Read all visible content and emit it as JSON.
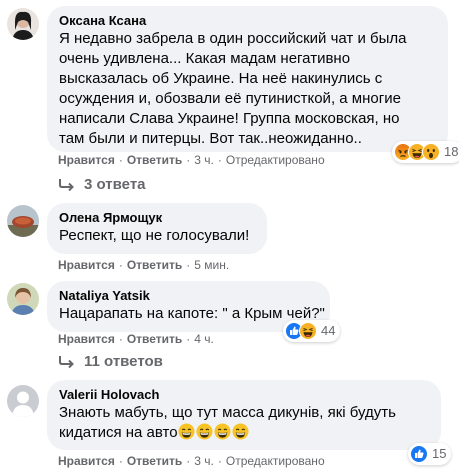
{
  "comments": [
    {
      "author": "Оксана Ксана",
      "lines": [
        "Я недавно забрела в один российский чат и была",
        "очень удивлена... Какая мадам негативно",
        "высказалась об Украине. На неё накинулись с",
        "осуждения и, обозвали её путинисткой, а многие",
        "написали Слава Украине! Группа московская, но",
        "там были и питерцы. Вот так..неожиданно.."
      ],
      "like_label": "Нравится",
      "reply_label": "Ответить",
      "time": "3 ч.",
      "edited": "Отредактировано",
      "reaction_count": "18",
      "reaction_icons": [
        "angry-reaction-icon",
        "haha-reaction-icon",
        "wow-reaction-icon"
      ],
      "replies_label": "3 ответа"
    },
    {
      "author": "Олена Ярмощук",
      "lines": [
        "Респект, що не голосували!"
      ],
      "like_label": "Нравится",
      "reply_label": "Ответить",
      "time": "5 мин."
    },
    {
      "author": "Nataliya Yatsik",
      "lines": [
        "Нацарапать на капоте: \" а Крым чей?\""
      ],
      "like_label": "Нравится",
      "reply_label": "Ответить",
      "time": "4 ч.",
      "reaction_count": "44",
      "reaction_icons": [
        "like-reaction-icon",
        "haha-reaction-icon"
      ],
      "replies_label": "11 ответов"
    },
    {
      "author": "Valerii Holovach",
      "lines": [
        "Знають мабуть, що тут масса дикунів, які будуть",
        "кидатися на авто"
      ],
      "trailing_emoji": [
        "grin-emoji",
        "grin-emoji",
        "grin-emoji",
        "grin-emoji"
      ],
      "like_label": "Нравится",
      "reply_label": "Ответить",
      "time": "3 ч.",
      "edited": "Отредактировано",
      "reaction_count": "15",
      "reaction_icons": [
        "like-reaction-icon"
      ]
    }
  ],
  "colors": {
    "bubble": "#f0f2f5",
    "meta_text": "#65676b",
    "like_blue": "#1877f2",
    "reaction_yellow": "#f7b125",
    "angry_orange": "#e9710f"
  }
}
